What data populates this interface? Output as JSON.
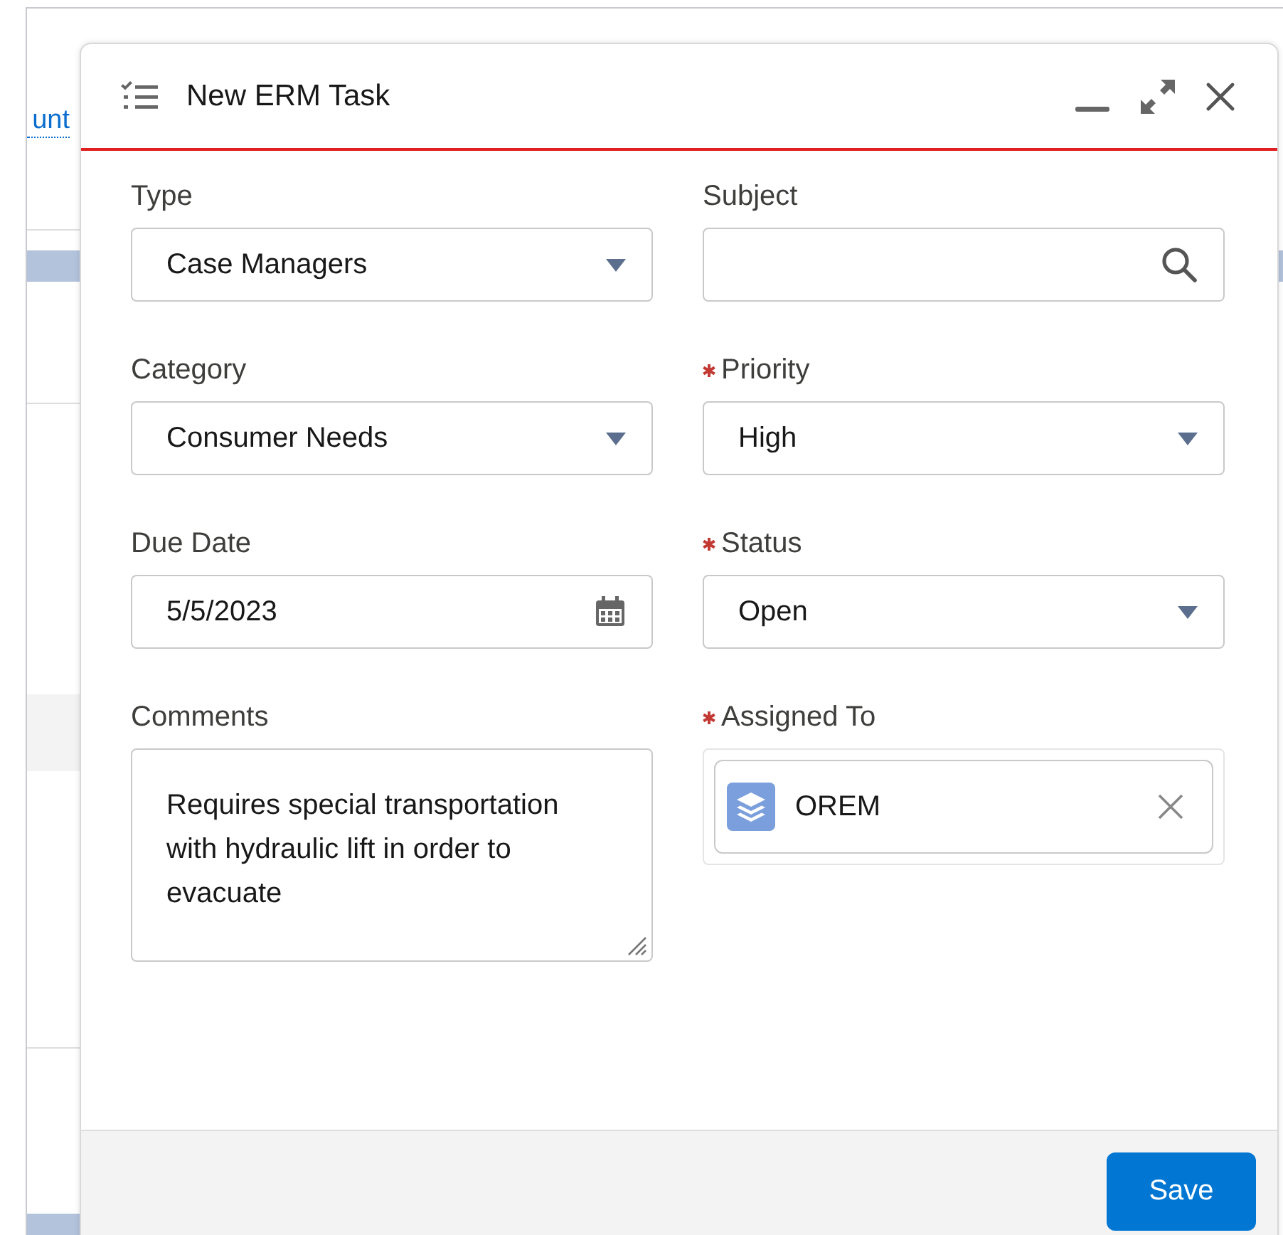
{
  "background": {
    "link": "unt"
  },
  "modal": {
    "title": "New ERM Task",
    "fields": [
      {
        "kind": "select",
        "label": "Type",
        "required": false,
        "value": "Case Managers"
      },
      {
        "kind": "lookup",
        "label": "Subject",
        "required": false
      },
      {
        "kind": "select",
        "label": "Category",
        "required": false,
        "value": "Consumer Needs"
      },
      {
        "kind": "select",
        "label": "Priority",
        "required": true,
        "value": "High"
      },
      {
        "kind": "date",
        "label": "Due Date",
        "required": false,
        "value": "5/5/2023"
      },
      {
        "kind": "select",
        "label": "Status",
        "required": true,
        "value": "Open"
      },
      {
        "kind": "textarea",
        "label": "Comments",
        "required": false,
        "value": "Requires special transportation with hydraulic lift in order to evacuate"
      },
      {
        "kind": "pill",
        "label": "Assigned To",
        "required": true,
        "value": "OREM"
      }
    ],
    "save_button": "Save"
  }
}
